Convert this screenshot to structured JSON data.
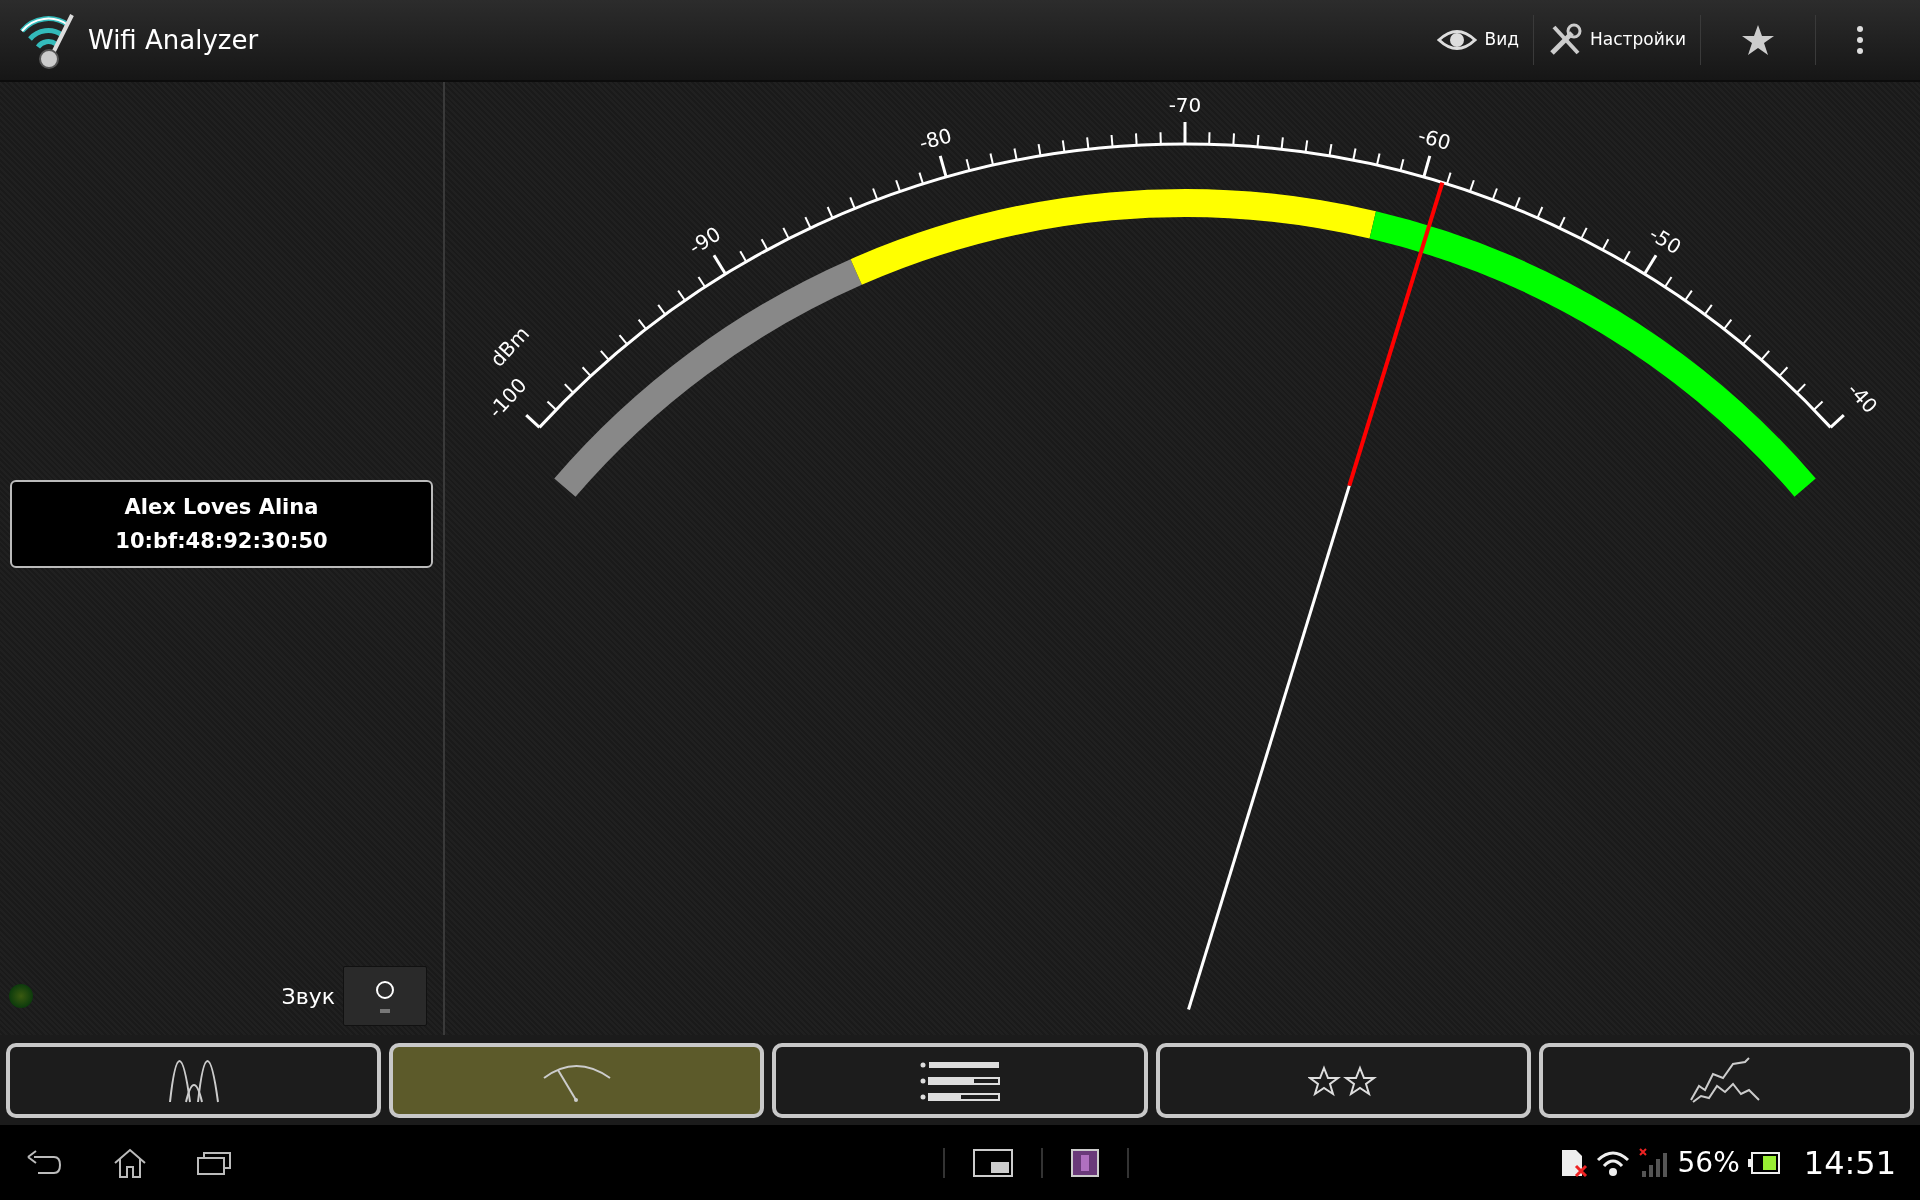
{
  "app_bar": {
    "title": "Wifi Analyzer",
    "actions": [
      {
        "kind": "view",
        "label": "Вид"
      },
      {
        "kind": "settings",
        "label": "Настройки"
      },
      {
        "kind": "favorite"
      },
      {
        "kind": "overflow"
      }
    ]
  },
  "network": {
    "ssid": "Alex Loves Alina",
    "bssid": "10:bf:48:92:30:50"
  },
  "sound": {
    "label": "Звук",
    "on": false
  },
  "meter": {
    "unit": "dBm",
    "tick_labels": [
      "-100",
      "-90",
      "-80",
      "-70",
      "-60",
      "-50",
      "-40"
    ],
    "zones": [
      {
        "color": "#888888"
      },
      {
        "color": "#ffff00"
      },
      {
        "color": "#00ff00"
      }
    ],
    "level": 0.68
  },
  "tabs": [
    {
      "kind": "channel_graph",
      "selected": false
    },
    {
      "kind": "meter",
      "selected": true
    },
    {
      "kind": "ap_list",
      "selected": false
    },
    {
      "kind": "rating",
      "selected": false
    },
    {
      "kind": "time_graph",
      "selected": false
    }
  ],
  "status_bar": {
    "battery": "56%",
    "time": "14:51"
  }
}
